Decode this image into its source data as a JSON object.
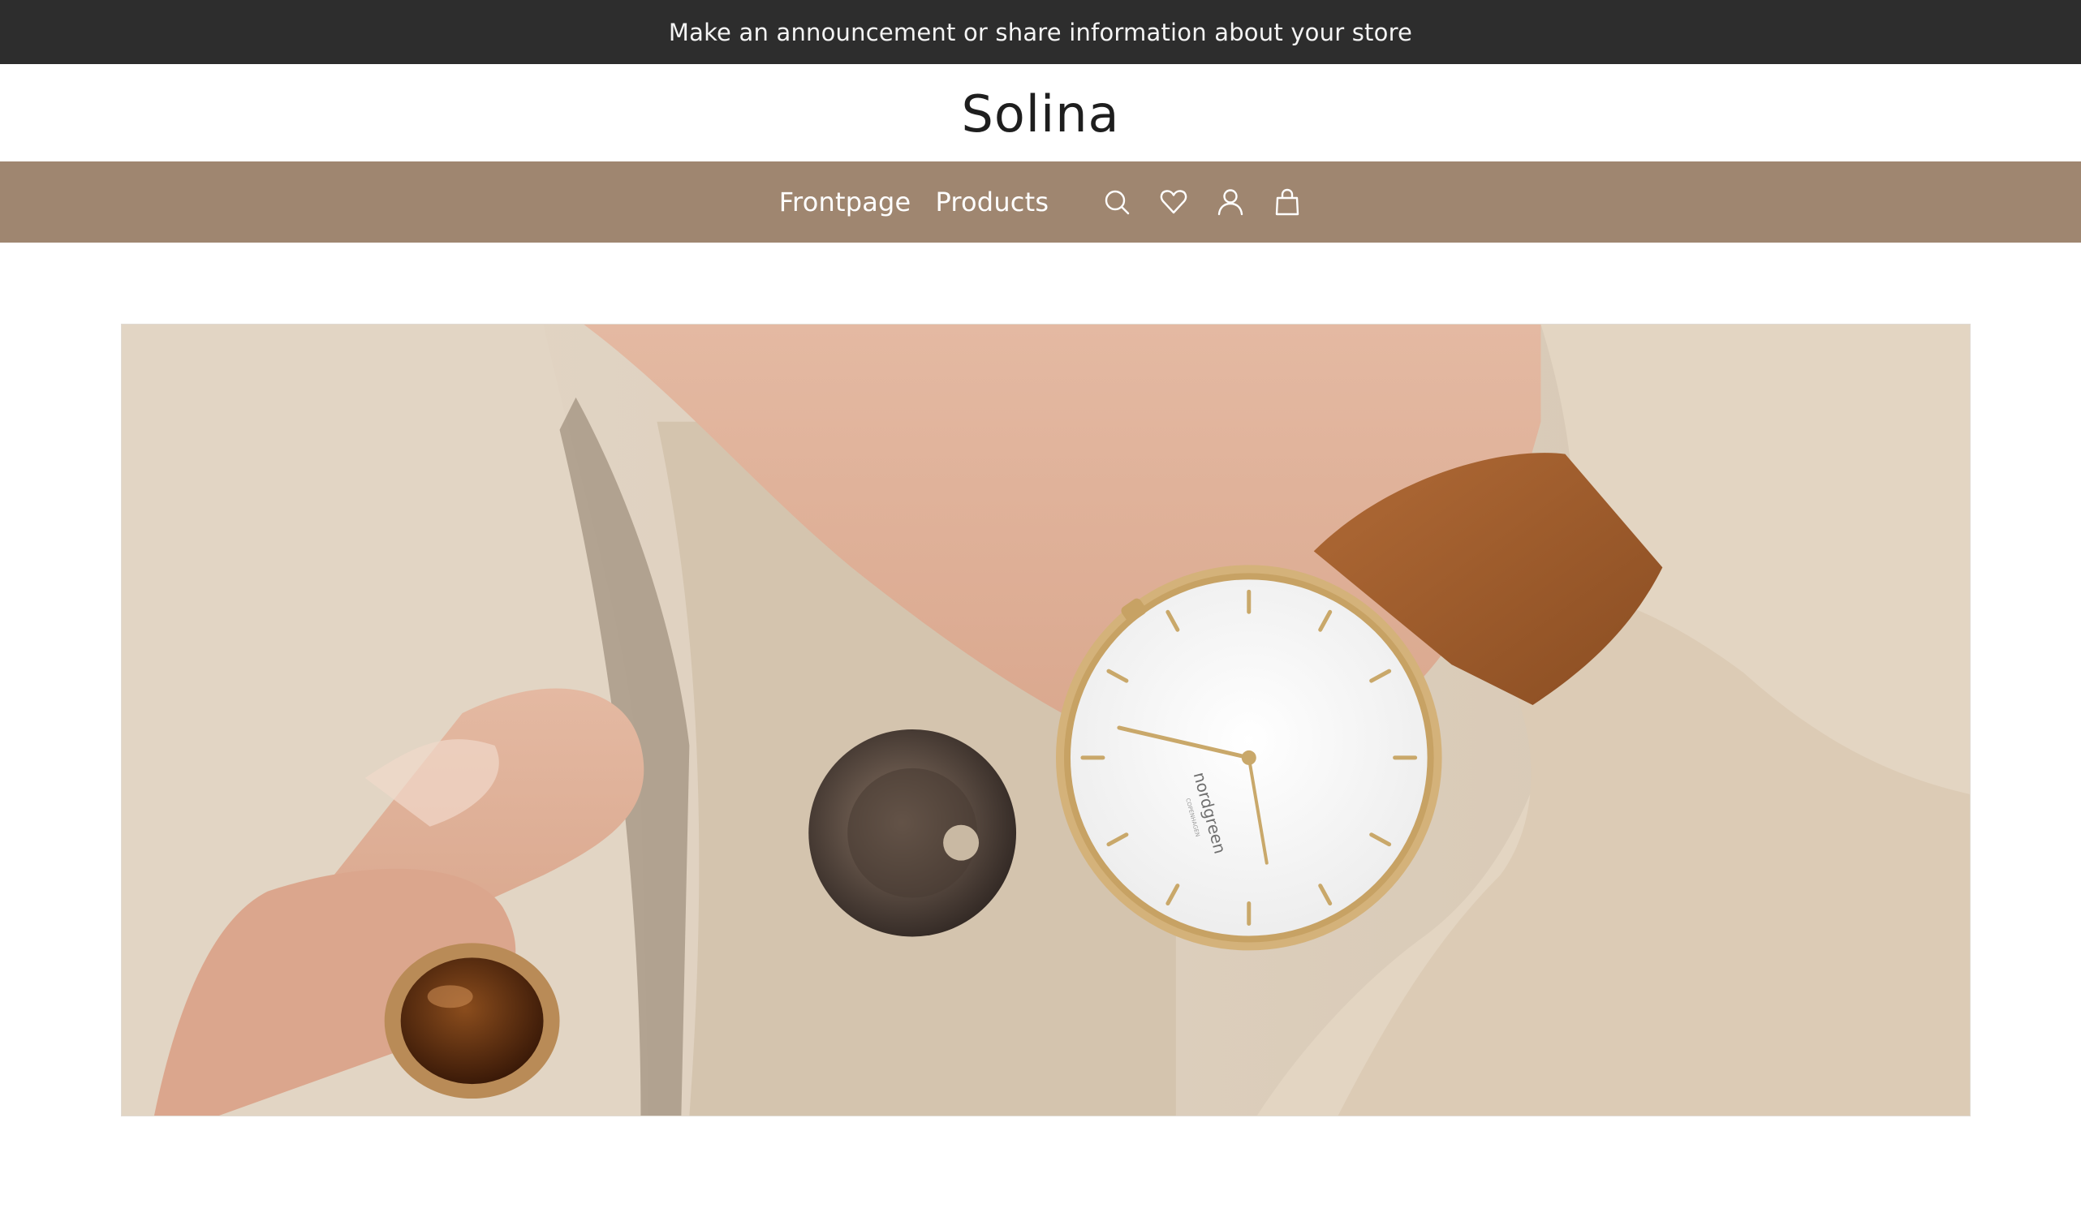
{
  "announcement": {
    "text": "Make an announcement or share information about your store"
  },
  "header": {
    "logo_text": "Solina"
  },
  "nav": {
    "links": [
      {
        "label": "Frontpage"
      },
      {
        "label": "Products"
      }
    ],
    "icons": [
      "search-icon",
      "heart-icon",
      "account-icon",
      "bag-icon"
    ]
  },
  "hero": {
    "watch_brand": "nordgreen",
    "watch_subtext": "COPENHAGEN"
  },
  "colors": {
    "announcement_bg": "#2d2d2d",
    "nav_bg": "#9f8670",
    "text_dark": "#1e1e1e"
  }
}
